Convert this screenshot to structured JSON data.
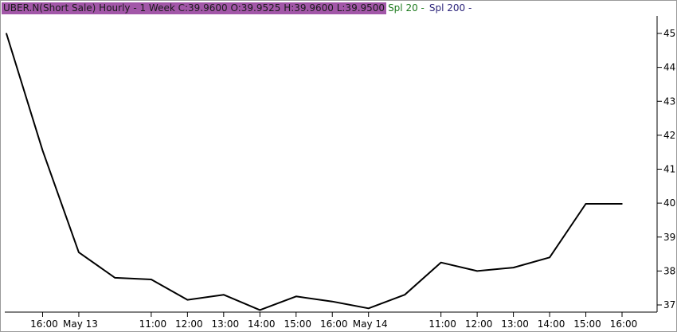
{
  "header": {
    "title_text": "UBER.N(Short Sale) Hourly -  1 Week   C:39.9600 O:39.9525 H:39.9600 L:39.9500",
    "legend_spl20": "Spl 20 -",
    "legend_spl200": "Spl 200 -",
    "title_bg": "#a257a8",
    "spl20_color": "#1e7b1e",
    "spl200_color": "#2b237a"
  },
  "chart_data": {
    "type": "line",
    "title": "UBER.N(Short Sale) Hourly -  1 Week",
    "ylim": [
      37,
      45
    ],
    "y_ticks": [
      37,
      38,
      39,
      40,
      41,
      42,
      43,
      44,
      45
    ],
    "x_tick_labels": [
      "16:00",
      "May 13",
      "11:00",
      "12:00",
      "13:00",
      "14:00",
      "15:00",
      "16:00",
      "May 14",
      "11:00",
      "12:00",
      "13:00",
      "14:00",
      "15:00",
      "16:00"
    ],
    "series": [
      {
        "values": [
          45.0,
          41.55,
          38.55,
          37.8,
          37.75,
          37.15,
          37.3,
          36.85,
          37.25,
          37.1,
          36.9,
          37.3,
          38.25,
          38.0,
          38.1,
          38.4,
          39.98,
          39.98
        ]
      }
    ],
    "last_values": {
      "C": "39.9600",
      "O": "39.9525",
      "H": "39.9600",
      "L": "39.9500"
    }
  }
}
